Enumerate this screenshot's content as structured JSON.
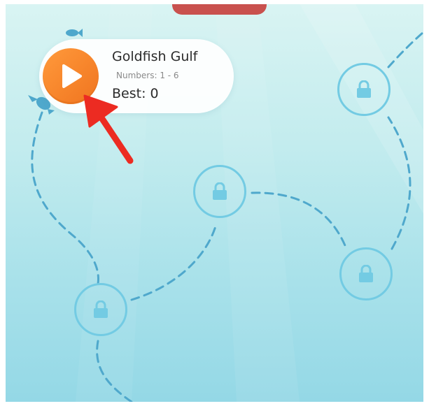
{
  "game": {
    "current_level": {
      "title": "Goldfish Gulf",
      "numbers_range": "Numbers: 1 - 6",
      "best": "Best: 0"
    },
    "locked_levels": [
      {
        "icon": "lock-icon",
        "state": "locked"
      },
      {
        "icon": "lock-icon",
        "state": "locked"
      },
      {
        "icon": "lock-icon",
        "state": "locked"
      },
      {
        "icon": "lock-icon",
        "state": "locked"
      }
    ],
    "decorations": [
      "fish-icon",
      "fish-icon"
    ],
    "annotation": "pointer-arrow-icon"
  },
  "colors": {
    "play_button": "#f7852b",
    "top_tab": "#c9514e",
    "lock_ring": "#73cbe3",
    "lock_icon": "#73cbe3",
    "path_dash": "#4fa8cc",
    "arrow": "#ec2b22",
    "background_top": "#d9f4f3",
    "background_bottom": "#94d8e6"
  }
}
